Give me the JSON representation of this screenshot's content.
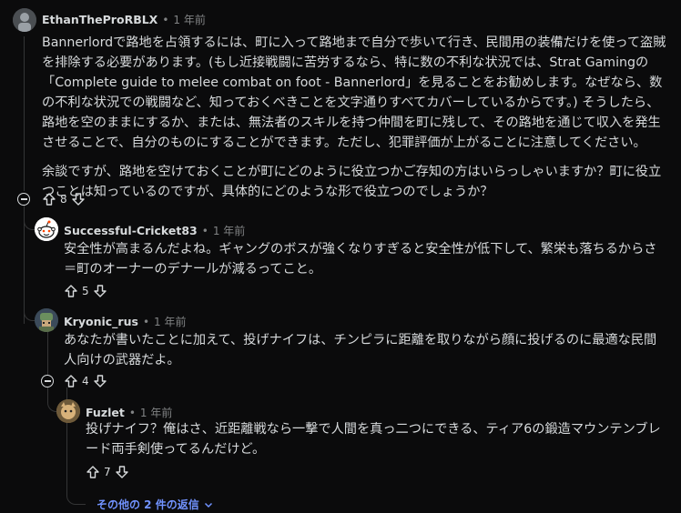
{
  "comment1": {
    "author": "EthanTheProRBLX",
    "time": "1 年前",
    "para1": "Bannerlordで路地を占領するには、町に入って路地まで自分で歩いて行き、民間用の装備だけを使って盗賊を排除する必要があります。(もし近接戦闘に苦労するなら、特に数の不利な状況では、Strat Gamingの「Complete guide to melee combat on foot - Bannerlord」を見ることをお勧めします。なぜなら、数の不利な状況での戦闘など、知っておくべきことを文字通りすべてカバーしているからです。) そうしたら、路地を空のままにするか、または、無法者のスキルを持つ仲間を町に残して、その路地を通じて収入を発生させることで、自分のものにすることができます。ただし、犯罪評価が上がることに注意してください。",
    "para2": "余談ですが、路地を空けておくことが町にどのように役立つかご存知の方はいらっしゃいますか？町に役立つことは知っているのですが、具体的にどのような形で役立つのでしょうか？",
    "votes": "8"
  },
  "comment2": {
    "author": "Successful-Cricket83",
    "time": "1 年前",
    "text": "安全性が高まるんだよね。ギャングのボスが強くなりすぎると安全性が低下して、繁栄も落ちるからさ＝町のオーナーのデナールが減るってこと。",
    "votes": "5"
  },
  "comment3": {
    "author": "Kryonic_rus",
    "time": "1 年前",
    "text": "あなたが書いたことに加えて、投げナイフは、チンピラに距離を取りながら顔に投げるのに最適な民間人向けの武器だよ。",
    "votes": "4"
  },
  "comment4": {
    "author": "Fuzlet",
    "time": "1 年前",
    "text": "投げナイフ？俺はさ、近距離戦なら一撃で人間を真っ二つにできる、ティア6の鍛造マウンテンブレード両手剣使ってるんだけど。",
    "votes": "7"
  },
  "more_replies": "その他の 2 件の返信",
  "colors": {
    "background": "#0b0b0c",
    "text": "#d7dadc",
    "muted": "#818384",
    "link": "#7193ff",
    "thread_line": "#343536"
  },
  "icons": [
    "avatar-ethan-icon",
    "reddit-snoo-avatar-icon",
    "avatar-kryonic-icon",
    "avatar-fuzlet-icon",
    "upvote-icon",
    "downvote-icon",
    "collapse-icon",
    "chevron-down-icon"
  ]
}
